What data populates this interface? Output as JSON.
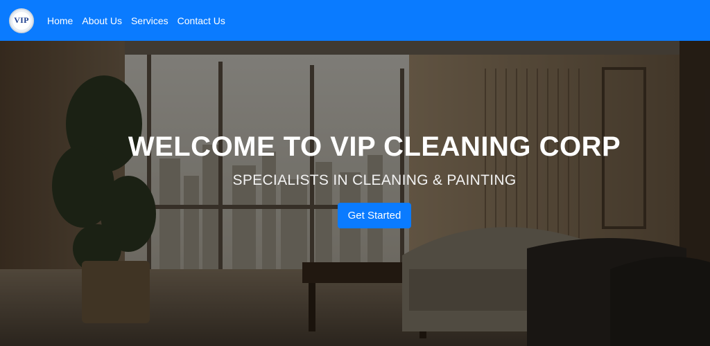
{
  "brand": {
    "logo_text": "VIP"
  },
  "nav": {
    "items": [
      {
        "label": "Home"
      },
      {
        "label": "About Us"
      },
      {
        "label": "Services"
      },
      {
        "label": "Contact Us"
      }
    ]
  },
  "hero": {
    "title": "WELCOME TO VIP CLEANING CORP",
    "subtitle": "SPECIALISTS IN CLEANING & PAINTING",
    "cta_label": "Get Started"
  },
  "colors": {
    "primary": "#0a7bff",
    "logo_text": "#1d3f8f"
  }
}
